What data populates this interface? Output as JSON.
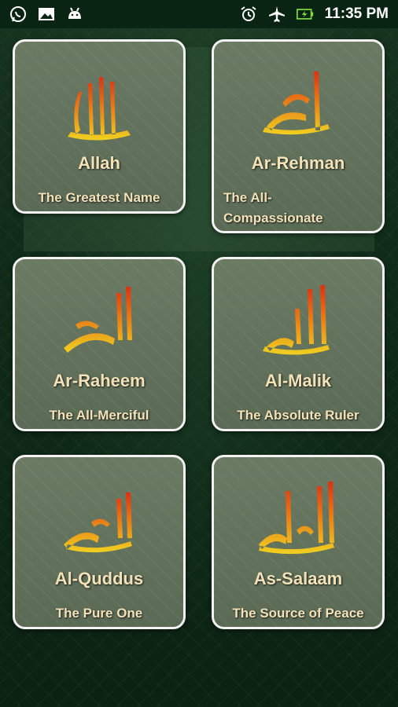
{
  "status_bar": {
    "time": "11:35 PM",
    "left_icons": [
      "whatsapp-icon",
      "image-icon",
      "android-icon"
    ],
    "right_icons": [
      "alarm-icon",
      "airplane-icon",
      "battery-icon"
    ]
  },
  "colors": {
    "card_border": "#f2f2f2",
    "text": "#f3e2b8",
    "calligraphy_top": "#e03010",
    "calligraphy_bottom": "#f0d020"
  },
  "cards": [
    {
      "name": "Allah",
      "meaning": "The Greatest Name"
    },
    {
      "name": "Ar-Rehman",
      "meaning": "The All-Compassionate"
    },
    {
      "name": "Ar-Raheem",
      "meaning": "The All-Merciful"
    },
    {
      "name": "Al-Malik",
      "meaning": "The Absolute Ruler"
    },
    {
      "name": "Al-Quddus",
      "meaning": "The Pure One"
    },
    {
      "name": "As-Salaam",
      "meaning": "The Source of Peace"
    }
  ]
}
